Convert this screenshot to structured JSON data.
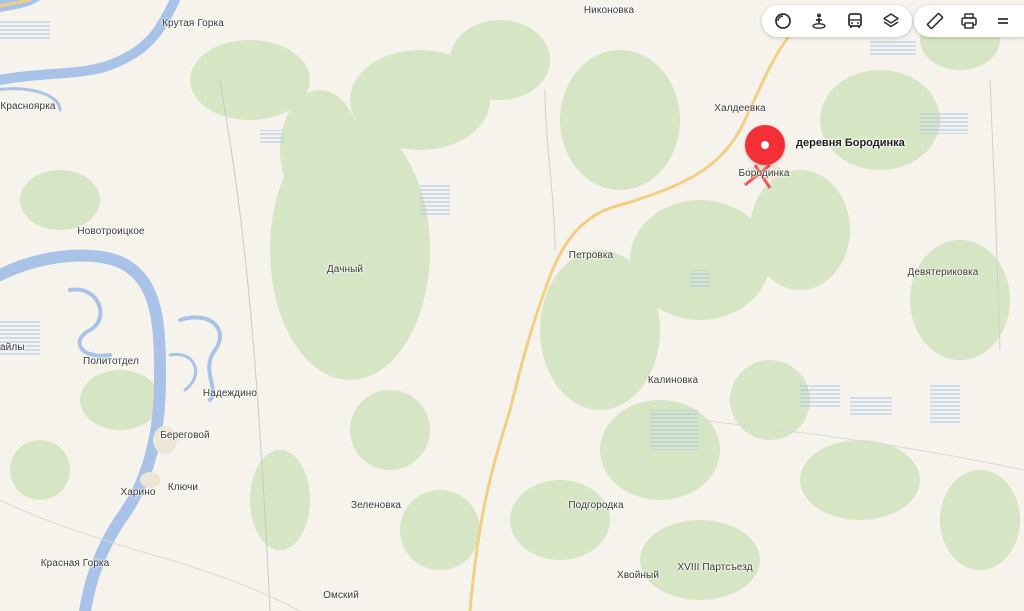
{
  "places": {
    "krutaya_gorka": "Крутая Горка",
    "nikonovka": "Никоновка",
    "krasnoyarka": "Красноярка",
    "khaldeevka": "Халдеевка",
    "borodinka": "Бородинка",
    "novotroitskoe": "Новотроицкое",
    "petrovka": "Петровка",
    "dachny": "Дачный",
    "devyaterikovka": "Девятериковка",
    "aily": "айлы",
    "politotdel": "Политотдел",
    "nadezhdino": "Надеждино",
    "kalinovka": "Калиновка",
    "beregovoy": "Береговой",
    "kharino": "Харино",
    "klyuchi": "Ключи",
    "zelenovka": "Зеленовка",
    "podgorodka": "Подгородка",
    "krasnaya_gorka": "Красная Горка",
    "xviii_partsyezd": "XVIII Партсъезд",
    "khvoyny": "Хвойный",
    "omsky": "Омский"
  },
  "pin": {
    "label": "деревня Бородинка"
  },
  "toolbar": {
    "icons": [
      "panorama-icon",
      "street-view-icon",
      "transit-icon",
      "layers-icon",
      "ruler-icon",
      "print-icon",
      "menu-icon"
    ]
  },
  "colors": {
    "background": "#f6f3ec",
    "forest": "#d6e5c4",
    "water": "#a9c3e8",
    "road": "#f3cf84",
    "pin": "#f23035"
  }
}
